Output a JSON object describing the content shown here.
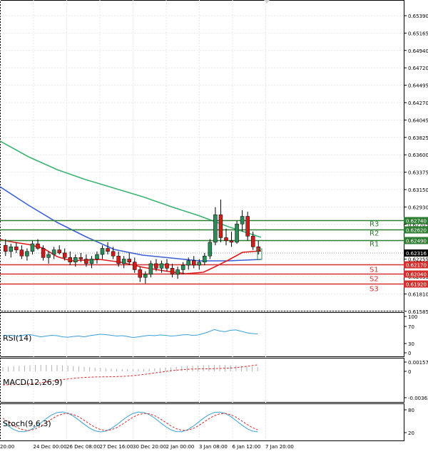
{
  "colors": {
    "background": "#ffffff",
    "grid": "#e8e8e8",
    "axis": "#000000",
    "candle_up": "#2e8b57",
    "candle_down": "#cc1f1a",
    "ma_fast": "#e01b1b",
    "ma_mid": "#3b5fd9",
    "ma_slow": "#3cb371",
    "resistance": "#2e7d32",
    "support": "#d32f2f",
    "price_tag": "#000000",
    "osc_line": "#3aa0d8",
    "osc_signal": "#d32f2f",
    "macd_hist": "#b0b0b0"
  },
  "main": {
    "price_labels": [
      "0.65390",
      "0.65165",
      "0.64940",
      "0.64720",
      "0.64495",
      "0.64270",
      "0.64045",
      "0.63825",
      "0.63600",
      "0.63375",
      "0.63150",
      "0.62930",
      "0.62705",
      "0.62480",
      "0.62255",
      "0.62035",
      "0.61810",
      "0.61585"
    ],
    "levels": [
      {
        "name": "R3",
        "value": "0.62740",
        "kind": "resistance"
      },
      {
        "name": "R2",
        "value": "0.62620",
        "kind": "resistance"
      },
      {
        "name": "R1",
        "value": "0.62490",
        "kind": "resistance"
      },
      {
        "name": "S1",
        "value": "0.62170",
        "kind": "support"
      },
      {
        "name": "S2",
        "value": "0.62040",
        "kind": "support"
      },
      {
        "name": "S3",
        "value": "0.61920",
        "kind": "support"
      }
    ],
    "current_price": "0.62316"
  },
  "time_labels": [
    "20:00",
    "24 Dec 00:00",
    "26 Dec 08:00",
    "27 Dec 16:00",
    "30 Dec 20:00",
    "2 Jan 00:00",
    "3 Jan 08:00",
    "6 Jan 12:00",
    "7 Jan 20:00"
  ],
  "rsi": {
    "label": "RSI(14)",
    "scale": [
      "100",
      "70",
      "30",
      "0"
    ]
  },
  "macd": {
    "label": "MACD(12,26,9)",
    "scale": [
      "0.00157",
      "0",
      "-0.00363"
    ]
  },
  "stoch": {
    "label": "Stoch(9,6,3)",
    "scale": [
      "80",
      "20"
    ]
  },
  "chart_data": {
    "type": "candlestick",
    "y_range": [
      0.6158,
      0.6554
    ],
    "candles": [
      [
        0.624,
        0.6248,
        0.6226,
        0.6232
      ],
      [
        0.6232,
        0.6242,
        0.6224,
        0.6238
      ],
      [
        0.6238,
        0.6244,
        0.623,
        0.6234
      ],
      [
        0.6234,
        0.624,
        0.6222,
        0.6226
      ],
      [
        0.6226,
        0.6236,
        0.622,
        0.6232
      ],
      [
        0.6232,
        0.6246,
        0.6228,
        0.6242
      ],
      [
        0.6242,
        0.6248,
        0.6234,
        0.6236
      ],
      [
        0.6236,
        0.624,
        0.622,
        0.6224
      ],
      [
        0.6224,
        0.6232,
        0.6216,
        0.6228
      ],
      [
        0.6228,
        0.6238,
        0.6222,
        0.6234
      ],
      [
        0.6234,
        0.624,
        0.6228,
        0.623
      ],
      [
        0.623,
        0.6236,
        0.622,
        0.6224
      ],
      [
        0.6224,
        0.6232,
        0.6214,
        0.6218
      ],
      [
        0.6218,
        0.6228,
        0.6212,
        0.6224
      ],
      [
        0.6224,
        0.623,
        0.6218,
        0.6222
      ],
      [
        0.6222,
        0.6228,
        0.6212,
        0.6216
      ],
      [
        0.6216,
        0.6226,
        0.621,
        0.6222
      ],
      [
        0.6222,
        0.6232,
        0.6216,
        0.6228
      ],
      [
        0.6228,
        0.624,
        0.6222,
        0.6236
      ],
      [
        0.6236,
        0.6244,
        0.6228,
        0.6232
      ],
      [
        0.6232,
        0.6238,
        0.6222,
        0.6226
      ],
      [
        0.6226,
        0.6232,
        0.6212,
        0.6216
      ],
      [
        0.6216,
        0.6226,
        0.621,
        0.6222
      ],
      [
        0.6222,
        0.623,
        0.6214,
        0.6218
      ],
      [
        0.6218,
        0.6224,
        0.6204,
        0.6208
      ],
      [
        0.6208,
        0.6212,
        0.6192,
        0.6198
      ],
      [
        0.6198,
        0.6206,
        0.619,
        0.6202
      ],
      [
        0.6202,
        0.622,
        0.6198,
        0.6216
      ],
      [
        0.6216,
        0.6222,
        0.6206,
        0.621
      ],
      [
        0.621,
        0.622,
        0.6204,
        0.6216
      ],
      [
        0.6216,
        0.6222,
        0.6206,
        0.621
      ],
      [
        0.621,
        0.6216,
        0.6198,
        0.6202
      ],
      [
        0.6202,
        0.6212,
        0.6196,
        0.6208
      ],
      [
        0.6208,
        0.6218,
        0.6202,
        0.6214
      ],
      [
        0.6214,
        0.6224,
        0.6208,
        0.622
      ],
      [
        0.622,
        0.6226,
        0.621,
        0.6214
      ],
      [
        0.6214,
        0.6222,
        0.6208,
        0.6218
      ],
      [
        0.6218,
        0.623,
        0.6214,
        0.6226
      ],
      [
        0.6226,
        0.6248,
        0.6222,
        0.6244
      ],
      [
        0.6244,
        0.629,
        0.624,
        0.628
      ],
      [
        0.628,
        0.63,
        0.6244,
        0.625
      ],
      [
        0.625,
        0.6262,
        0.624,
        0.6246
      ],
      [
        0.6246,
        0.6258,
        0.6238,
        0.6244
      ],
      [
        0.6244,
        0.6272,
        0.6242,
        0.6268
      ],
      [
        0.6268,
        0.6286,
        0.6258,
        0.6278
      ],
      [
        0.6278,
        0.6284,
        0.6246,
        0.6252
      ],
      [
        0.6252,
        0.6258,
        0.6234,
        0.6238
      ],
      [
        0.6238,
        0.6246,
        0.6228,
        0.6232
      ]
    ]
  }
}
